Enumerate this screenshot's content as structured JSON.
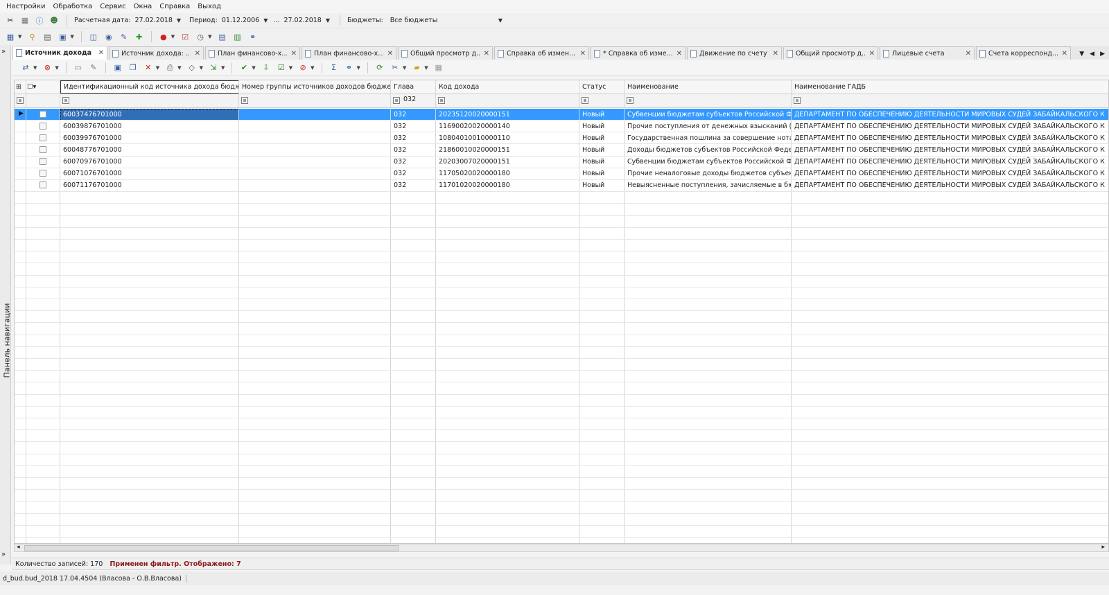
{
  "menu": [
    "Настройки",
    "Обработка",
    "Сервис",
    "Окна",
    "Справка",
    "Выход"
  ],
  "params": {
    "calc_date_label": "Расчетная дата:",
    "calc_date": "27.02.2018",
    "period_label": "Период:",
    "period_from": "01.12.2006",
    "period_sep": "...",
    "period_to": "27.02.2018",
    "budgets_label": "Бюджеты:",
    "budgets_value": "Все бюджеты"
  },
  "nav_panel_label": "Панель навигации",
  "tabs": [
    {
      "label": "Источник дохода",
      "active": true
    },
    {
      "label": "Источник дохода: ...",
      "active": false
    },
    {
      "label": "План финансово-х...",
      "active": false
    },
    {
      "label": "План финансово-х...",
      "active": false
    },
    {
      "label": "Общий просмотр д...",
      "active": false
    },
    {
      "label": "Справка об измен...",
      "active": false
    },
    {
      "label": "* Справка об изме...",
      "active": false
    },
    {
      "label": "Движение по счету",
      "active": false
    },
    {
      "label": "Общий просмотр д...",
      "active": false
    },
    {
      "label": "Лицевые счета",
      "active": false
    },
    {
      "label": "Счета корреспонд...",
      "active": false
    }
  ],
  "grid": {
    "columns": [
      "Идентификационный код источника дохода бюджета",
      "Номер группы источников доходов бюджет",
      "Глава",
      "Код дохода",
      "Статус",
      "Наименование",
      "Наименование ГАДБ"
    ],
    "filter_glava": "032",
    "rows": [
      {
        "id": "60037476701000",
        "group": "",
        "glava": "032",
        "code": "20235120020000151",
        "status": "Новый",
        "name": "Субвенции бюджетам субъектов Российской Фе...",
        "gadb": "ДЕПАРТАМЕНТ ПО ОБЕСПЕЧЕНИЮ ДЕЯТЕЛЬНОСТИ МИРОВЫХ СУДЕЙ ЗАБАЙКАЛЬСКОГО К"
      },
      {
        "id": "60039876701000",
        "group": "",
        "glava": "032",
        "code": "11690020020000140",
        "status": "Новый",
        "name": "Прочие поступления от денежных взысканий (ш...",
        "gadb": "ДЕПАРТАМЕНТ ПО ОБЕСПЕЧЕНИЮ ДЕЯТЕЛЬНОСТИ МИРОВЫХ СУДЕЙ ЗАБАЙКАЛЬСКОГО К"
      },
      {
        "id": "60039976701000",
        "group": "",
        "glava": "032",
        "code": "10804010010000110",
        "status": "Новый",
        "name": "Государственная пошлина за совершение нотар...",
        "gadb": "ДЕПАРТАМЕНТ ПО ОБЕСПЕЧЕНИЮ ДЕЯТЕЛЬНОСТИ МИРОВЫХ СУДЕЙ ЗАБАЙКАЛЬСКОГО К"
      },
      {
        "id": "60048776701000",
        "group": "",
        "glava": "032",
        "code": "21860010020000151",
        "status": "Новый",
        "name": "Доходы бюджетов субъектов Российской Федер...",
        "gadb": "ДЕПАРТАМЕНТ ПО ОБЕСПЕЧЕНИЮ ДЕЯТЕЛЬНОСТИ МИРОВЫХ СУДЕЙ ЗАБАЙКАЛЬСКОГО К"
      },
      {
        "id": "60070976701000",
        "group": "",
        "glava": "032",
        "code": "20203007020000151",
        "status": "Новый",
        "name": "Субвенции бюджетам субъектов Российской Фе...",
        "gadb": "ДЕПАРТАМЕНТ ПО ОБЕСПЕЧЕНИЮ ДЕЯТЕЛЬНОСТИ МИРОВЫХ СУДЕЙ ЗАБАЙКАЛЬСКОГО К"
      },
      {
        "id": "60071076701000",
        "group": "",
        "glava": "032",
        "code": "11705020020000180",
        "status": "Новый",
        "name": "Прочие неналоговые доходы бюджетов субъект...",
        "gadb": "ДЕПАРТАМЕНТ ПО ОБЕСПЕЧЕНИЮ ДЕЯТЕЛЬНОСТИ МИРОВЫХ СУДЕЙ ЗАБАЙКАЛЬСКОГО К"
      },
      {
        "id": "60071176701000",
        "group": "",
        "glava": "032",
        "code": "11701020020000180",
        "status": "Новый",
        "name": "Невыясненные поступления, зачисляемые в бю...",
        "gadb": "ДЕПАРТАМЕНТ ПО ОБЕСПЕЧЕНИЮ ДЕЯТЕЛЬНОСТИ МИРОВЫХ СУДЕЙ ЗАБАЙКАЛЬСКОГО К"
      }
    ]
  },
  "status": {
    "records": "Количество записей: 170",
    "filter": "Применен фильтр. Отображено: 7",
    "session": "d_bud.bud_2018 17.04.4504 (Власова - О.В.Власова)"
  },
  "colors": {
    "selection": "#3399ff",
    "filter_text": "#8b1a1a"
  }
}
